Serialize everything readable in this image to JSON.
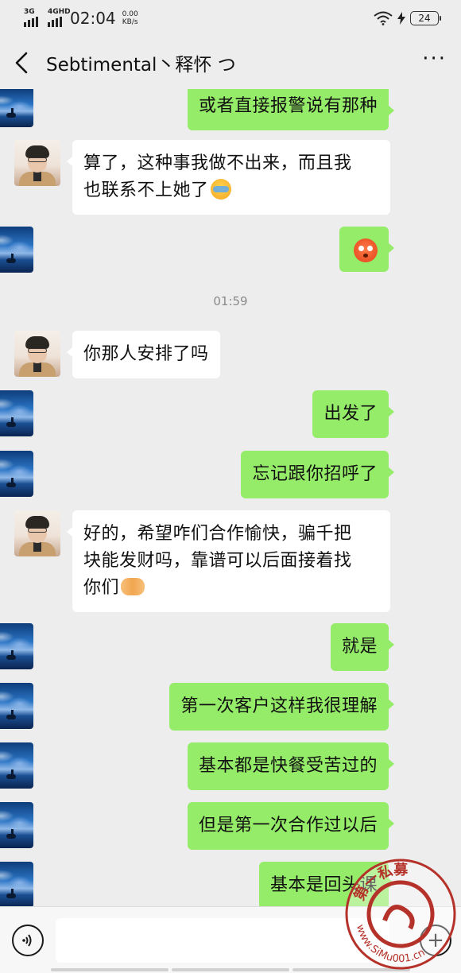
{
  "status_bar": {
    "network_left": "3G",
    "network_right": "4GHD",
    "time": "02:04",
    "speed_value": "0.00",
    "speed_unit": "KB/s",
    "battery": "24"
  },
  "header": {
    "title": "Sebtimental丶释怀 つ"
  },
  "messages": [
    {
      "side": "out",
      "text": "或者直接报警说有那种"
    },
    {
      "side": "in",
      "line1": "算了，这种事我做不出来，而且我",
      "line2": "也联系不上她了"
    },
    {
      "side": "out",
      "emoji": "shocked-emoji"
    },
    {
      "side": "in",
      "text": "你那人安排了吗"
    },
    {
      "side": "out",
      "text": "出发了"
    },
    {
      "side": "out",
      "text": "忘记跟你招呼了"
    },
    {
      "side": "in",
      "line1": "好的，希望咋们合作愉快，骗千把",
      "line2": "块能发财吗，靠谱可以后面接着找",
      "line3": "你们"
    },
    {
      "side": "out",
      "text": "就是"
    },
    {
      "side": "out",
      "text": "第一次客户这样我很理解"
    },
    {
      "side": "out",
      "text": "基本都是快餐受苦过的"
    },
    {
      "side": "out",
      "text": "但是第一次合作过以后"
    },
    {
      "side": "out",
      "text": "基本是回头课"
    }
  ],
  "timestamp": "01:59",
  "watermark": {
    "text": "第一私募",
    "url": "www.SiMu001.cn"
  },
  "colors": {
    "outgoing_bubble": "#95ec69",
    "incoming_bubble": "#ffffff",
    "background": "#ededed"
  }
}
